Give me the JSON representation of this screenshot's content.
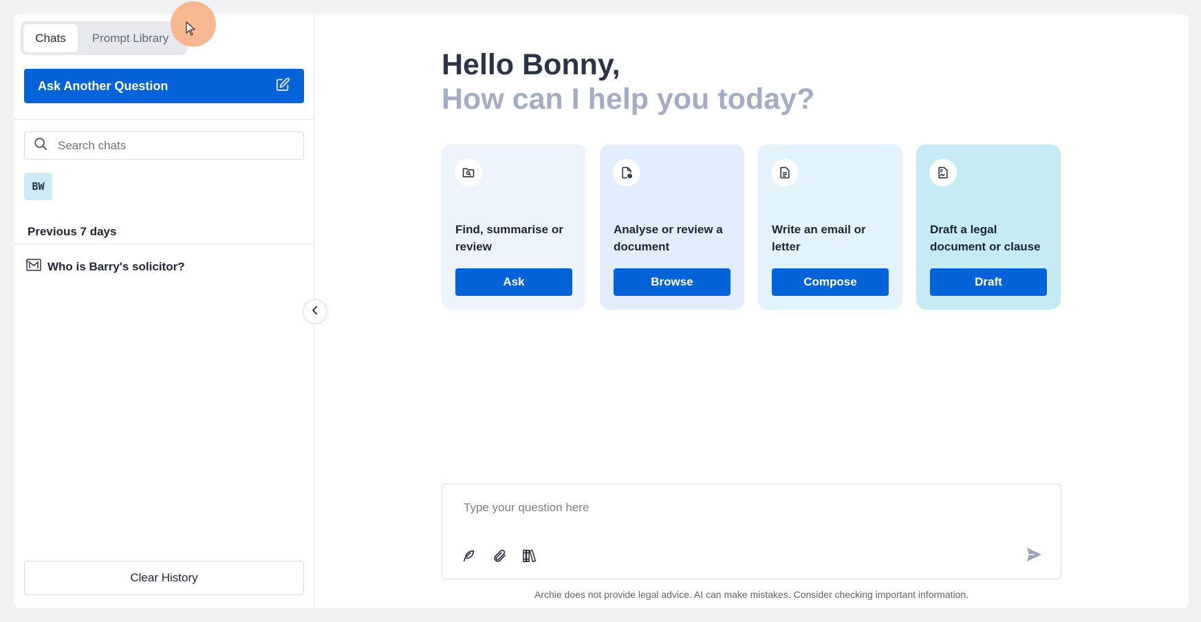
{
  "sidebar": {
    "tabs": [
      {
        "label": "Chats",
        "active": true
      },
      {
        "label": "Prompt Library",
        "active": false
      }
    ],
    "ask_button_label": "Ask Another Question",
    "search_placeholder": "Search chats",
    "avatar_initials": "BW",
    "section_label": "Previous 7 days",
    "chats": [
      {
        "title": "Who is Barry's solicitor?",
        "icon": "gmail-icon"
      }
    ],
    "clear_history_label": "Clear History"
  },
  "main": {
    "greeting_line1": "Hello Bonny,",
    "greeting_line2": "How can I help you today?",
    "cards": [
      {
        "title": "Find, summarise or review",
        "button": "Ask",
        "icon": "folder-search-icon",
        "bg": "#eef4fd"
      },
      {
        "title": "Analyse or review a document",
        "button": "Browse",
        "icon": "file-question-icon",
        "bg": "#e2edfb"
      },
      {
        "title": "Write an email or letter",
        "button": "Compose",
        "icon": "document-text-icon",
        "bg": "#e2f3fb"
      },
      {
        "title": "Draft a legal document or clause",
        "button": "Draft",
        "icon": "file-signature-icon",
        "bg": "#c6ebf4"
      }
    ],
    "composer": {
      "placeholder": "Type your question here",
      "tools": [
        "quill-icon",
        "paperclip-icon",
        "library-icon"
      ],
      "send_icon": "send-icon"
    },
    "disclaimer": "Archie does not provide legal advice. AI can make mistakes. Consider checking important information."
  },
  "colors": {
    "primary": "#0563d9",
    "greeting_dark": "#2b3448",
    "greeting_light": "#a3adc6"
  }
}
